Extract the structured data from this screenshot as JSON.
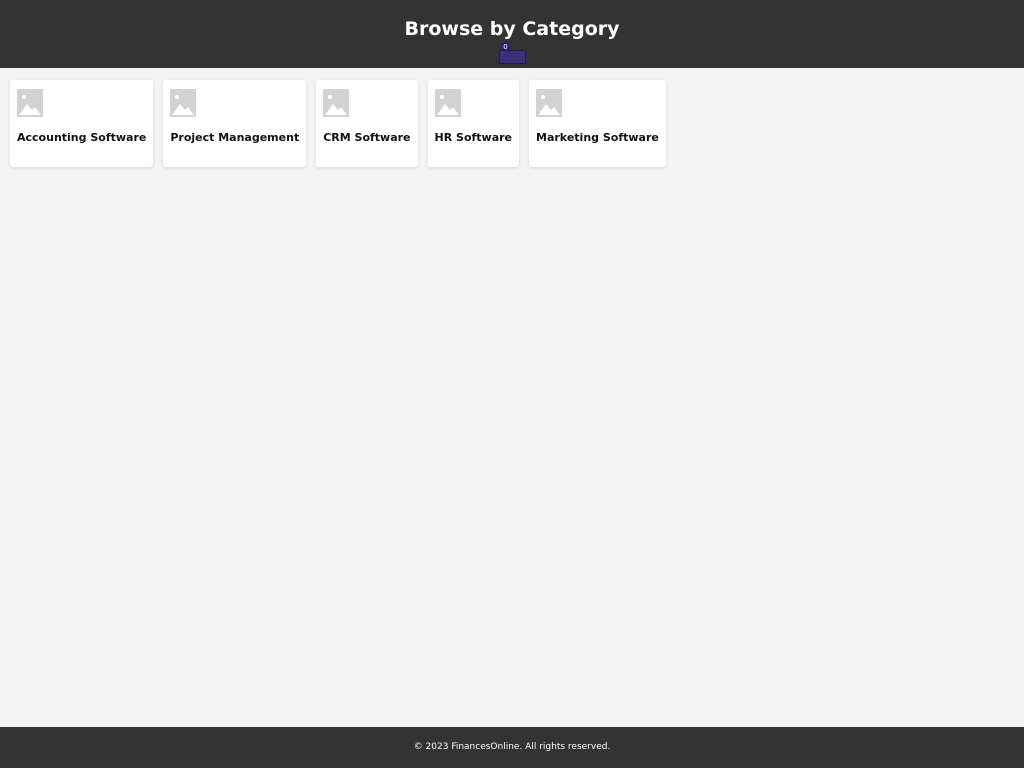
{
  "header": {
    "title": "Browse by Category",
    "badge_count": "0"
  },
  "categories": [
    {
      "label": "Accounting Software",
      "icon": "image-placeholder-icon"
    },
    {
      "label": "Project Management",
      "icon": "image-placeholder-icon"
    },
    {
      "label": "CRM Software",
      "icon": "image-placeholder-icon"
    },
    {
      "label": "HR Software",
      "icon": "image-placeholder-icon"
    },
    {
      "label": "Marketing Software",
      "icon": "image-placeholder-icon"
    }
  ],
  "footer": {
    "text": "© 2023 FinancesOnline. All rights reserved."
  },
  "colors": {
    "header_bg": "#333333",
    "page_bg": "#f3f3f3",
    "badge": "#3c2f7a"
  }
}
